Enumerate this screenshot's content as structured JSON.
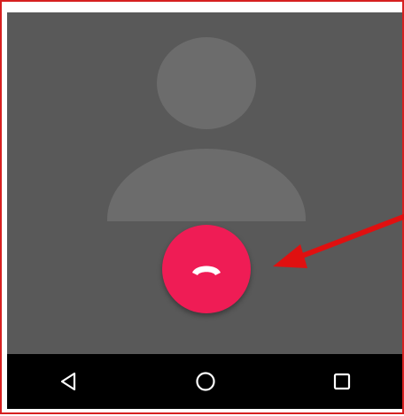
{
  "screen": {
    "background": "#595959",
    "avatar": {
      "icon": "person-silhouette-icon",
      "color": "#6c6c6c"
    }
  },
  "call": {
    "end_call_button": {
      "icon": "call-end-icon",
      "color": "#ef1c55"
    }
  },
  "navigation_bar": {
    "background": "#000000",
    "buttons": [
      {
        "icon": "back-triangle-icon"
      },
      {
        "icon": "home-circle-icon"
      },
      {
        "icon": "recents-square-icon"
      }
    ]
  },
  "annotation": {
    "arrow_color": "#e01010",
    "frame_color": "#d62020"
  }
}
